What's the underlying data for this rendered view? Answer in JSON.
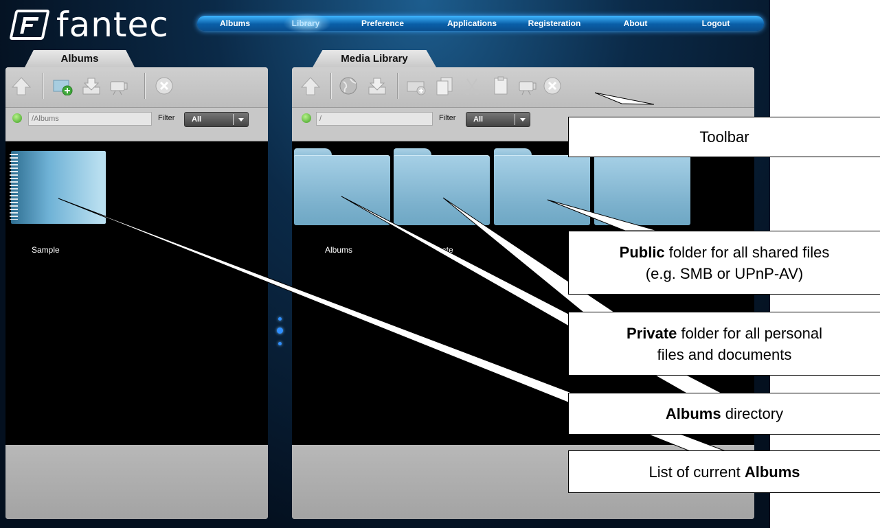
{
  "logo": {
    "text": "fantec"
  },
  "nav": {
    "items": [
      {
        "label": "Albums",
        "active": false
      },
      {
        "label": "Library",
        "active": true
      },
      {
        "label": "Preference",
        "active": false
      },
      {
        "label": "Applications",
        "active": false
      },
      {
        "label": "Registeration",
        "active": false
      },
      {
        "label": "About",
        "active": false
      },
      {
        "label": "Logout",
        "active": false
      }
    ]
  },
  "albums_panel": {
    "tab_label": "Albums",
    "toolbar_icons": [
      "up-arrow-icon",
      "new-album-icon",
      "download-icon",
      "slideshow-icon",
      "delete-icon"
    ],
    "path": {
      "placeholder": "/Albums"
    },
    "filter": {
      "label": "Filter",
      "value": "All"
    },
    "items": [
      {
        "label": "Sample",
        "icon": "album-icon"
      }
    ]
  },
  "library_panel": {
    "tab_label": "Media Library",
    "toolbar_icons": [
      "up-arrow-icon",
      "globe-icon",
      "download-icon",
      "new-folder-icon",
      "copy-icon",
      "cut-icon",
      "paste-icon",
      "slideshow-icon",
      "delete-icon"
    ],
    "path": {
      "placeholder": "/"
    },
    "filter": {
      "label": "Filter",
      "value": "All"
    },
    "items": [
      {
        "label": "Albums",
        "icon": "folder-icon"
      },
      {
        "label": "vate",
        "icon": "folder-icon"
      },
      {
        "label": "",
        "icon": "folder-icon"
      },
      {
        "label": "",
        "icon": "folder-icon"
      }
    ]
  },
  "callouts": {
    "toolbar": {
      "text": "Toolbar"
    },
    "public": {
      "bold": "Public",
      "line1_rest": " folder for all shared files",
      "line2": "(e.g. SMB or UPnP-AV)"
    },
    "private": {
      "bold": "Private",
      "line1_rest": " folder for all personal",
      "line2": "files and documents"
    },
    "albums_dir": {
      "bold": "Albums",
      "rest": " directory"
    },
    "album_list": {
      "prefix": "List of current ",
      "bold": "Albums"
    }
  },
  "colors": {
    "nav_accent": "#1e86d6",
    "panel_gray": "#c8c8c8",
    "folder_blue": "#8bbcd6",
    "background": "#0b2a48"
  }
}
